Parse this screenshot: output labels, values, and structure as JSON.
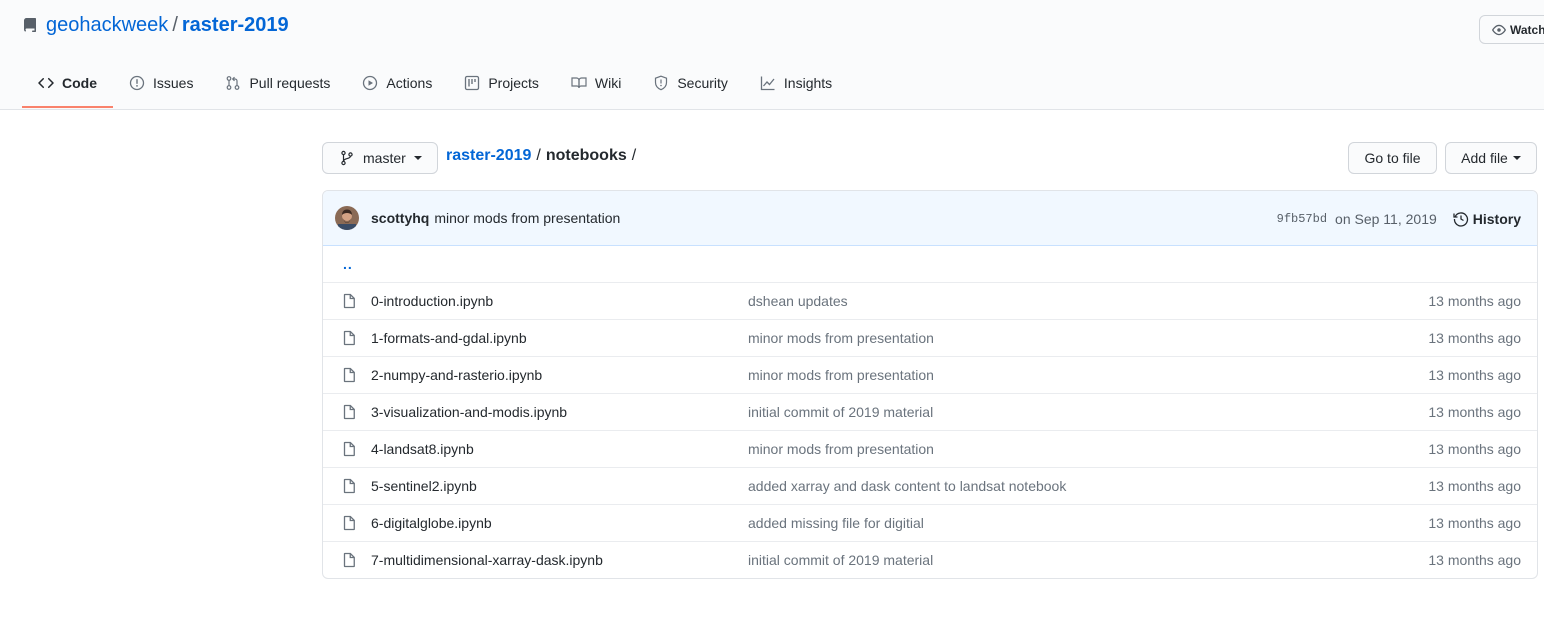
{
  "repo": {
    "owner": "geohackweek",
    "separator": "/",
    "name": "raster-2019"
  },
  "watch_button": {
    "label": "Watch"
  },
  "tabs": [
    {
      "label": "Code",
      "icon": "code-icon",
      "active": true
    },
    {
      "label": "Issues",
      "icon": "issue-icon",
      "active": false
    },
    {
      "label": "Pull requests",
      "icon": "pull-request-icon",
      "active": false
    },
    {
      "label": "Actions",
      "icon": "play-icon",
      "active": false
    },
    {
      "label": "Projects",
      "icon": "project-icon",
      "active": false
    },
    {
      "label": "Wiki",
      "icon": "book-icon",
      "active": false
    },
    {
      "label": "Security",
      "icon": "shield-icon",
      "active": false
    },
    {
      "label": "Insights",
      "icon": "graph-icon",
      "active": false
    }
  ],
  "toolbar": {
    "branch": "master",
    "breadcrumb_repo": "raster-2019",
    "breadcrumb_sep": "/",
    "breadcrumb_dir": "notebooks",
    "breadcrumb_trailing": "/",
    "go_to_file": "Go to file",
    "add_file": "Add file"
  },
  "latest_commit": {
    "author": "scottyhq",
    "message": "minor mods from presentation",
    "sha": "9fb57bd",
    "date": "on Sep 11, 2019",
    "history_label": "History"
  },
  "parent_dir": "..",
  "files": [
    {
      "name": "0-introduction.ipynb",
      "commit": "dshean updates",
      "age": "13 months ago"
    },
    {
      "name": "1-formats-and-gdal.ipynb",
      "commit": "minor mods from presentation",
      "age": "13 months ago"
    },
    {
      "name": "2-numpy-and-rasterio.ipynb",
      "commit": "minor mods from presentation",
      "age": "13 months ago"
    },
    {
      "name": "3-visualization-and-modis.ipynb",
      "commit": "initial commit of 2019 material",
      "age": "13 months ago"
    },
    {
      "name": "4-landsat8.ipynb",
      "commit": "minor mods from presentation",
      "age": "13 months ago"
    },
    {
      "name": "5-sentinel2.ipynb",
      "commit": "added xarray and dask content to landsat notebook",
      "age": "13 months ago"
    },
    {
      "name": "6-digitalglobe.ipynb",
      "commit": "added missing file for digitial",
      "age": "13 months ago"
    },
    {
      "name": "7-multidimensional-xarray-dask.ipynb",
      "commit": "initial commit of 2019 material",
      "age": "13 months ago"
    }
  ],
  "colors": {
    "link": "#0366d6",
    "active_tab_underline": "#f9826c",
    "commit_bar_bg": "#f1f8ff",
    "muted_text": "#6a737d"
  }
}
